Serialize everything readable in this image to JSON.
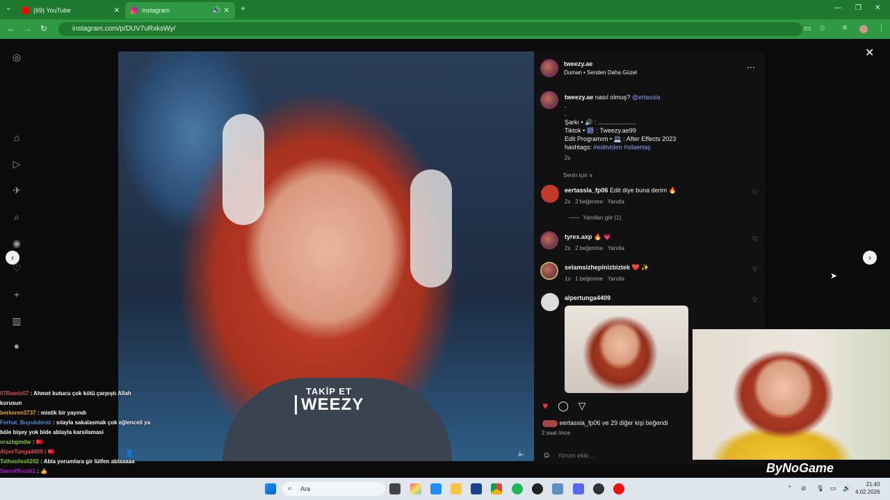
{
  "browser": {
    "tabs": [
      {
        "label": "(69) YouTube",
        "active": false
      },
      {
        "label": "Instagram",
        "active": true
      }
    ],
    "url": "instagram.com/p/DUV7uRxksWy/",
    "accent": "#2f9a43"
  },
  "post": {
    "username": "tweezy.ae",
    "audio": "Duman • Senden Daha Güzel",
    "overlay_line1": "TAKİP ET",
    "overlay_line2": "WEEZY",
    "caption": {
      "user": "tweezy.ae",
      "text": "nasıl olmuş?",
      "mention": "@ertassla",
      "line1": ".",
      "line2": ".",
      "line3": "Şarkı • 🔊 : ......................",
      "line4": "Tiktok • 🎆 : Tweezy.ae99",
      "line5": "Edit Programım • 💻 : After Effects 2023",
      "line6_prefix": "hashtags:",
      "line6_tags": "#editvideo #silaertaş",
      "time": "2s"
    },
    "filter": "Senin için ∨",
    "comments": [
      {
        "user": "eertassla_fp06",
        "text": "Edit diye buna derim 🔥",
        "time": "2s",
        "likes": "2 beğenme",
        "reply": "Yanıtla"
      },
      {
        "user": "tyrex.axp",
        "text": "🔥 💗",
        "time": "2s",
        "likes": "2 beğenme",
        "reply": "Yanıtla"
      },
      {
        "user": "selamsizhepinizbiztek",
        "text": "❤️ ✨",
        "time": "1s",
        "likes": "1 beğenme",
        "reply": "Yanıtla"
      },
      {
        "user": "alpertunga4409",
        "text": "",
        "time": "",
        "likes": "",
        "reply": ""
      }
    ],
    "replies_toggle": "Yanıtları gör (1)",
    "liked_by": "eertassla_fp06 ve 29 diğer kişi beğendi",
    "posted": "2 saat önce",
    "comment_placeholder": "Yorum ekle..."
  },
  "chat": [
    {
      "user": "07Ramiz07",
      "text": ": Ahmet kutucu çok kötü çarpıştı Allah",
      "color": "#e84a5f"
    },
    {
      "user": "",
      "text": "korusun",
      "color": "#ffffff"
    },
    {
      "user": "berkeren3737",
      "text": ": mistik bir yayındı",
      "color": "#f5a623"
    },
    {
      "user": "Ferhat_Buyukdeniz",
      "text": ": sılayla sakalasmak çok eğlenceli ya",
      "color": "#4a90e2"
    },
    {
      "user": "",
      "text": "böle bişey yok bide ablayla karsilamasi",
      "color": "#ffffff"
    },
    {
      "user": "orazbgmdw",
      "text": ": 🇹🇷",
      "color": "#7ed321"
    },
    {
      "user": "AlperTunga4409",
      "text": ": 🇹🇷",
      "color": "#e84a5f"
    },
    {
      "user": "Talhasilva0202",
      "text": ": Abla yorumlara gir lütfen ablaaaaa",
      "color": "#7ed321"
    },
    {
      "user": "SametTerzi61",
      "text": ": 👍",
      "color": "#bd10e0"
    }
  ],
  "stream": {
    "watermark": "ByNoGame"
  },
  "taskbar": {
    "search": "Ara",
    "time": "21:40",
    "date": "4.02.2026"
  }
}
